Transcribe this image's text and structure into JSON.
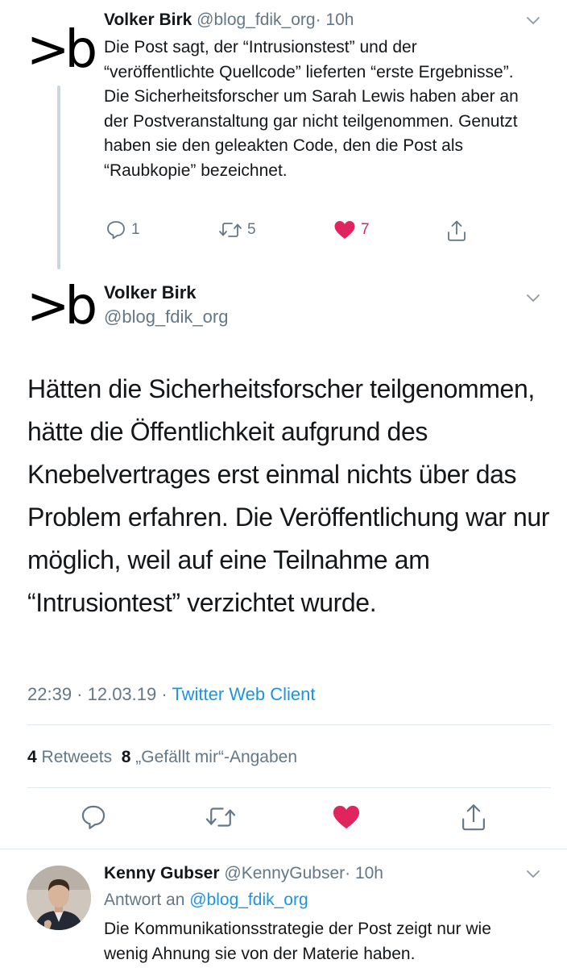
{
  "tweet1": {
    "avatar_text": ">b",
    "name": "Volker Birk",
    "handle": "@blog_fdik_org",
    "time": "· 10h",
    "text": "Die Post sagt, der “Intrusionstest” und der “veröffentlichte Quellcode” lieferten “erste Ergebnisse”. Die Sicherheitsforscher um Sarah Lewis haben aber an der Postveranstaltung gar nicht teilgenommen. Genutzt haben sie den geleakten Code, den die Post als “Raubkopie” bezeichnet.",
    "reply_count": "1",
    "retweet_count": "5",
    "like_count": "7",
    "icons": {
      "reply": "reply-icon",
      "retweet": "retweet-icon",
      "like": "heart-icon",
      "share": "share-icon",
      "menu": "chevron-down-icon"
    }
  },
  "tweet2": {
    "avatar_text": ">b",
    "name": "Volker Birk",
    "handle": "@blog_fdik_org",
    "text": "Hätten die Sicherheitsforscher teilgenommen, hätte die Öffentlichkeit aufgrund des Knebelvertrages erst einmal nichts über das Problem erfahren. Die Veröffentlichung war nur möglich, weil auf eine Teilnahme am “Intrusiontest” verzichtet wurde.",
    "timestamp": "22:39 · 12.03.19 · ",
    "source": "Twitter Web Client",
    "retweets_count": "4",
    "retweets_label": "Retweets",
    "likes_count": "8",
    "likes_label": "„Gefällt mir“-Angaben"
  },
  "reply": {
    "name": "Kenny Gubser",
    "handle": "@KennyGubser",
    "time": "· 10h",
    "reply_prefix": "Antwort an ",
    "reply_to": "@blog_fdik_org",
    "text": "Die Kommunikationsstrategie der Post zeigt nur wie wenig Ahnung sie von der Materie haben."
  },
  "colors": {
    "text": "#14171a",
    "secondary": "#657786",
    "link": "#1b95e0",
    "like": "#e0245e",
    "divider": "#e1e8ed",
    "thread_line": "#ccd6dd"
  }
}
